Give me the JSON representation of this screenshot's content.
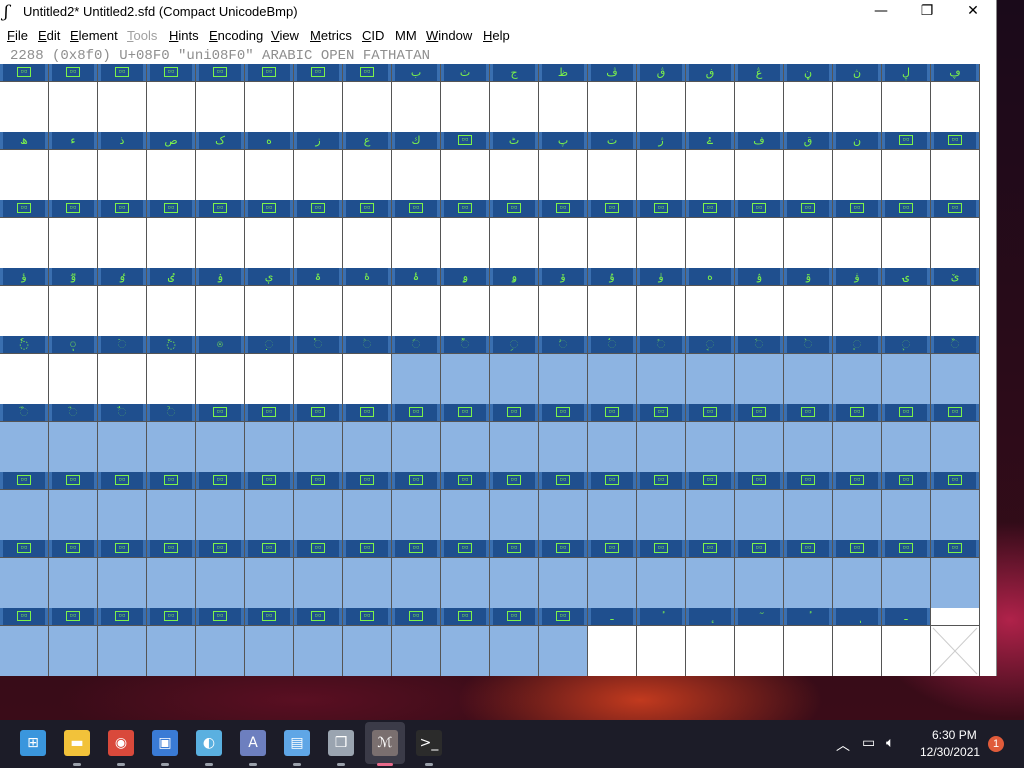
{
  "window": {
    "title": "Untitled2*  Untitled2.sfd (Compact UnicodeBmp)",
    "controls": {
      "minimize": "—",
      "maximize": "❐",
      "close": "✕"
    }
  },
  "menu": [
    {
      "label": "File",
      "acc": "F",
      "rest": "ile",
      "enabled": true
    },
    {
      "label": "Edit",
      "acc": "E",
      "rest": "dit",
      "enabled": true
    },
    {
      "label": "Element",
      "acc": "E",
      "rest": "lement",
      "enabled": true
    },
    {
      "label": "Tools",
      "acc": "T",
      "rest": "ools",
      "enabled": false
    },
    {
      "label": "Hints",
      "acc": "H",
      "rest": "ints",
      "enabled": true
    },
    {
      "label": "Encoding",
      "acc": "E",
      "rest": "ncoding",
      "enabled": true
    },
    {
      "label": "View",
      "acc": "V",
      "rest": "iew",
      "enabled": true
    },
    {
      "label": "Metrics",
      "acc": "M",
      "rest": "etrics",
      "enabled": true
    },
    {
      "label": "CID",
      "acc": "C",
      "rest": "ID",
      "enabled": true
    },
    {
      "label": "MM",
      "acc": "",
      "rest": "MM",
      "enabled": true
    },
    {
      "label": "Window",
      "acc": "W",
      "rest": "indow",
      "enabled": true
    },
    {
      "label": "Help",
      "acc": "H",
      "rest": "elp",
      "enabled": true
    }
  ],
  "info_line": "2288 (0x8f0) U+08F0 \"uni08F0\" ARABIC OPEN FATHATAN",
  "grid": {
    "rows": [
      {
        "glyphs": [
          "▯",
          "▯",
          "▯",
          "▯",
          "▯",
          "▯",
          "▯",
          "▯",
          "ب",
          "ث",
          "ج",
          "ظ",
          "ڤ",
          "ڨ",
          "ڧ",
          "ڠ",
          "ڼ",
          "ڽ",
          "ڸ",
          "ڥ"
        ],
        "selected": [
          false,
          false,
          false,
          false,
          false,
          false,
          false,
          false,
          false,
          false,
          false,
          false,
          false,
          false,
          false,
          false,
          false,
          false,
          false,
          false
        ]
      },
      {
        "glyphs": [
          "ھ",
          "ء",
          "ذ",
          "ص",
          "ک",
          "ه",
          "ز",
          "ع",
          "ك",
          "▯",
          "ٹ",
          "پ",
          "ت",
          "ژ",
          "ۓ",
          "ف",
          "ق",
          "ن",
          "▯",
          "▯"
        ],
        "selected": [
          false,
          false,
          false,
          false,
          false,
          false,
          false,
          false,
          false,
          false,
          false,
          false,
          false,
          false,
          false,
          false,
          false,
          false,
          false,
          false
        ]
      },
      {
        "glyphs": [
          "▯",
          "▯",
          "▯",
          "▯",
          "▯",
          "▯",
          "▯",
          "▯",
          "▯",
          "▯",
          "▯",
          "▯",
          "▯",
          "▯",
          "▯",
          "▯",
          "▯",
          "▯",
          "▯",
          "▯"
        ],
        "selected": [
          false,
          false,
          false,
          false,
          false,
          false,
          false,
          false,
          false,
          false,
          false,
          false,
          false,
          false,
          false,
          false,
          false,
          false,
          false,
          false
        ]
      },
      {
        "glyphs": [
          "ؤ",
          "ٷ",
          "ٶ",
          "ٸ",
          "ۏ",
          "ې",
          "ۃ",
          "ۀ",
          "ۂ",
          "ۄ",
          "ۅ",
          "ۆ",
          "ۇ",
          "ۈ",
          "ە",
          "ۉ",
          "ۊ",
          "ۋ",
          "ۍ",
          "ێ"
        ],
        "selected": [
          false,
          false,
          false,
          false,
          false,
          false,
          false,
          false,
          false,
          false,
          false,
          false,
          false,
          false,
          false,
          false,
          false,
          false,
          false,
          false
        ]
      },
      {
        "glyphs": [
          "◌ٗ",
          "◌ٖ",
          "◌ٙ",
          "◌ٚ",
          "◌ٛ",
          "◌ٜ",
          "◌ٝ",
          "◌ٞ",
          "◌ࣰ",
          "◌ࣱ",
          "◌ࣲ",
          "◌ࣳ",
          "◌ࣴ",
          "◌ࣵ",
          "◌ࣶ",
          "◌ࣷ",
          "◌ࣸ",
          "◌ࣹ",
          "◌ࣺ",
          "◌ࣻ"
        ],
        "selected": [
          false,
          false,
          false,
          false,
          false,
          false,
          false,
          false,
          true,
          true,
          true,
          true,
          true,
          true,
          true,
          true,
          true,
          true,
          true,
          true
        ]
      },
      {
        "glyphs": [
          "◌ࣼ",
          "◌ࣽ",
          "◌ࣾ",
          "◌ࣿ",
          "▯",
          "▯",
          "▯",
          "▯",
          "▯",
          "▯",
          "▯",
          "▯",
          "▯",
          "▯",
          "▯",
          "▯",
          "▯",
          "▯",
          "▯",
          "▯"
        ],
        "selected": [
          true,
          true,
          true,
          true,
          true,
          true,
          true,
          true,
          true,
          true,
          true,
          true,
          true,
          true,
          true,
          true,
          true,
          true,
          true,
          true
        ]
      },
      {
        "glyphs": [
          "▯",
          "▯",
          "▯",
          "▯",
          "▯",
          "▯",
          "▯",
          "▯",
          "▯",
          "▯",
          "▯",
          "▯",
          "▯",
          "▯",
          "▯",
          "▯",
          "▯",
          "▯",
          "▯",
          "▯"
        ],
        "selected": [
          true,
          true,
          true,
          true,
          true,
          true,
          true,
          true,
          true,
          true,
          true,
          true,
          true,
          true,
          true,
          true,
          true,
          true,
          true,
          true
        ]
      },
      {
        "glyphs": [
          "▯",
          "▯",
          "▯",
          "▯",
          "▯",
          "▯",
          "▯",
          "▯",
          "▯",
          "▯",
          "▯",
          "▯",
          "▯",
          "▯",
          "▯",
          "▯",
          "▯",
          "▯",
          "▯",
          "▯"
        ],
        "selected": [
          true,
          true,
          true,
          true,
          true,
          true,
          true,
          true,
          true,
          true,
          true,
          true,
          true,
          true,
          true,
          true,
          true,
          true,
          true,
          true
        ]
      },
      {
        "glyphs": [
          "▯",
          "▯",
          "▯",
          "▯",
          "▯",
          "▯",
          "▯",
          "▯",
          "▯",
          "▯",
          "▯",
          "▯",
          "ـ",
          "ٔ",
          "ٕ",
          "ٓ",
          "ٔ",
          "ٖ",
          "ـ",
          ""
        ],
        "selected": [
          true,
          true,
          true,
          true,
          true,
          true,
          true,
          true,
          true,
          true,
          true,
          true,
          false,
          false,
          false,
          false,
          false,
          false,
          false,
          false
        ]
      }
    ]
  },
  "taskbar": {
    "apps": [
      {
        "name": "start-icon",
        "glyph": "⊞",
        "color": "#3a96dd"
      },
      {
        "name": "file-explorer-icon",
        "glyph": "▬",
        "color": "#f2c23a"
      },
      {
        "name": "chrome-icon",
        "glyph": "◉",
        "color": "#d9493b"
      },
      {
        "name": "store-icon",
        "glyph": "▣",
        "color": "#3a7bd5"
      },
      {
        "name": "paint-icon",
        "glyph": "◐",
        "color": "#5ab0e0"
      },
      {
        "name": "fontforge-a-icon",
        "glyph": "A",
        "color": "#6d7fbf"
      },
      {
        "name": "notepad-icon",
        "glyph": "▤",
        "color": "#5fa6e6"
      },
      {
        "name": "virtualbox-icon",
        "glyph": "❒",
        "color": "#9aa4b0"
      },
      {
        "name": "fontforge-icon",
        "glyph": "ℳ",
        "color": "#7a6f6f"
      },
      {
        "name": "terminal-icon",
        "glyph": ">_",
        "color": "#2b2b2b"
      }
    ],
    "time": "6:30 PM",
    "date": "12/30/2021",
    "notifications": "1"
  }
}
